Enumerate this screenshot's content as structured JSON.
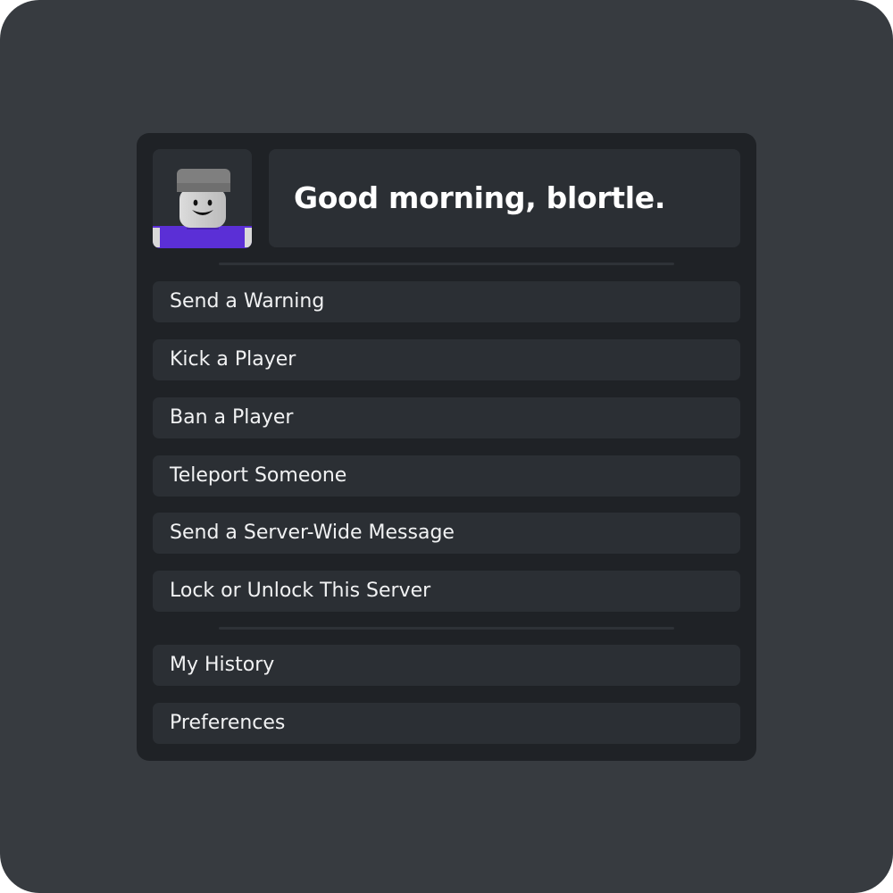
{
  "header": {
    "greeting": "Good morning, blortle.",
    "avatar_icon": "player-avatar-icon"
  },
  "menu": {
    "items": [
      {
        "label": "Send a Warning"
      },
      {
        "label": "Kick a Player"
      },
      {
        "label": "Ban a Player"
      },
      {
        "label": "Teleport Someone"
      },
      {
        "label": "Send a Server-Wide Message"
      },
      {
        "label": "Lock or Unlock This Server"
      },
      {
        "label": "My History"
      },
      {
        "label": "Preferences"
      }
    ]
  },
  "colors": {
    "backdrop": "#373b40",
    "panel": "#1f2226",
    "item": "#2b2f34",
    "text": "#ffffff",
    "avatar_shirt": "#5b2fd6"
  }
}
